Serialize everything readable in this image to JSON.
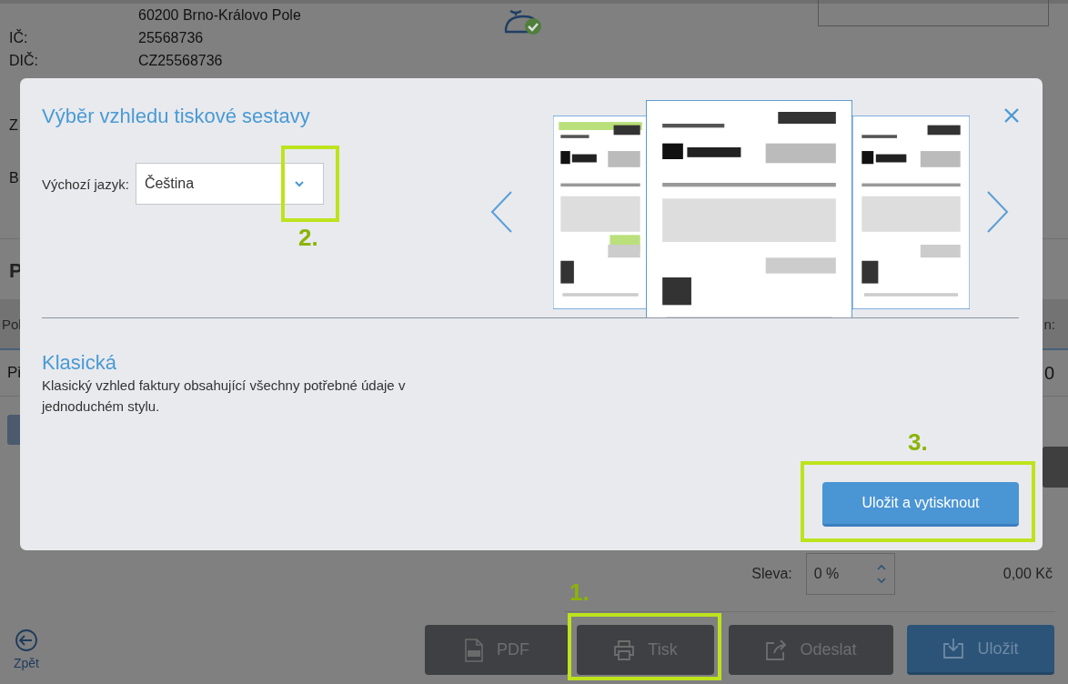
{
  "background": {
    "address": [
      {
        "value": "60200 Brno-Královo Pole"
      },
      {
        "label": "IČ:",
        "value": "25568736"
      },
      {
        "label": "DIČ:",
        "value": "CZ25568736"
      }
    ],
    "cut_labels": [
      "Z",
      "B"
    ],
    "section_heading": "P",
    "table_header": {
      "column_1": "Pol",
      "column_2": "n:"
    },
    "table_row": {
      "column_1": "Př",
      "column_2": "0"
    },
    "discount": {
      "label": "Sleva:",
      "value": "0 %",
      "total": "0,00 Kč"
    },
    "back": "Zpět",
    "actions": [
      {
        "label": "PDF",
        "kind": "pdf",
        "primary": false
      },
      {
        "label": "Tisk",
        "kind": "print",
        "primary": false
      },
      {
        "label": "Odeslat",
        "kind": "send",
        "primary": false
      },
      {
        "label": "Uložit",
        "kind": "save",
        "primary": true
      }
    ]
  },
  "dialog": {
    "title": "Výběr vzhledu tiskové sestavy",
    "language": {
      "label": "Výchozí jazyk:",
      "value": "Čeština"
    },
    "template_name": "Klasická",
    "template_description": "Klasický vzhled faktury obsahující všechny potřebné údaje v jednoduchém stylu.",
    "confirm": "Uložit a vytisknout"
  },
  "callouts": [
    {
      "number": "1."
    },
    {
      "number": "2."
    },
    {
      "number": "3."
    }
  ]
}
